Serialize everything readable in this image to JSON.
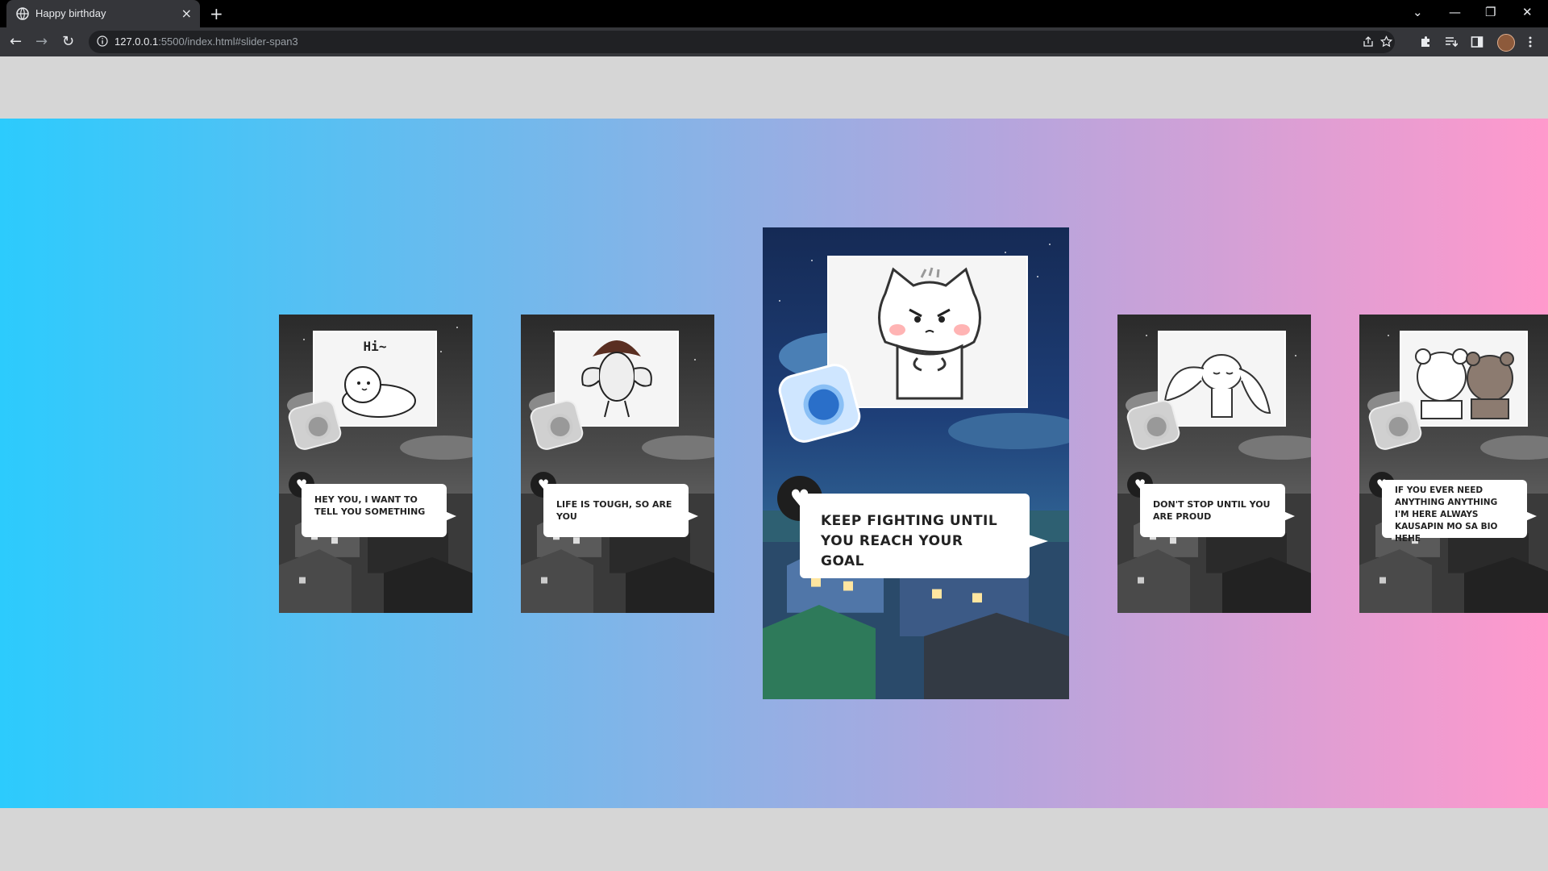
{
  "browser": {
    "tab_title": "Happy birthday",
    "tab_close": "×",
    "new_tab": "+",
    "window_controls": {
      "dropdown": "⌄",
      "minimize": "—",
      "restore": "❐",
      "close": "✕"
    },
    "nav": {
      "back": "←",
      "forward": "→",
      "reload": "↻"
    },
    "url_host": "127.0.0.1",
    "url_rest": ":5500/index.html#slider-span3",
    "toolbar_icons": [
      "share-icon",
      "star-icon",
      "extensions-icon",
      "reading-list-icon",
      "side-panel-icon",
      "avatar",
      "menu-icon"
    ]
  },
  "slider": {
    "gradient": [
      "#2ccbfd",
      "#ff99cc"
    ],
    "cards": [
      {
        "theme": "gray",
        "photo_text": "Hi~",
        "character": "seal",
        "message": "HEY YOU, I WANT TO TELL YOU SOMETHING",
        "active": false
      },
      {
        "theme": "gray",
        "photo_text": "",
        "character": "muscle-seal",
        "message": "LIFE IS TOUGH, SO ARE YOU",
        "active": false
      },
      {
        "theme": "blue",
        "photo_text": "",
        "character": "cat",
        "message": "KEEP FIGHTING UNTIL YOU REACH YOUR GOAL",
        "active": true
      },
      {
        "theme": "gray",
        "photo_text": "",
        "character": "bunny",
        "message": "DON'T STOP UNTIL YOU ARE PROUD",
        "active": false
      },
      {
        "theme": "gray",
        "photo_text": "",
        "character": "bears",
        "message": "IF YOU EVER NEED ANYTHING ANYTHING I'M HERE ALWAYS KAUSAPIN MO SA BIO HEHE",
        "active": false
      }
    ],
    "heart_icon": "♥"
  }
}
